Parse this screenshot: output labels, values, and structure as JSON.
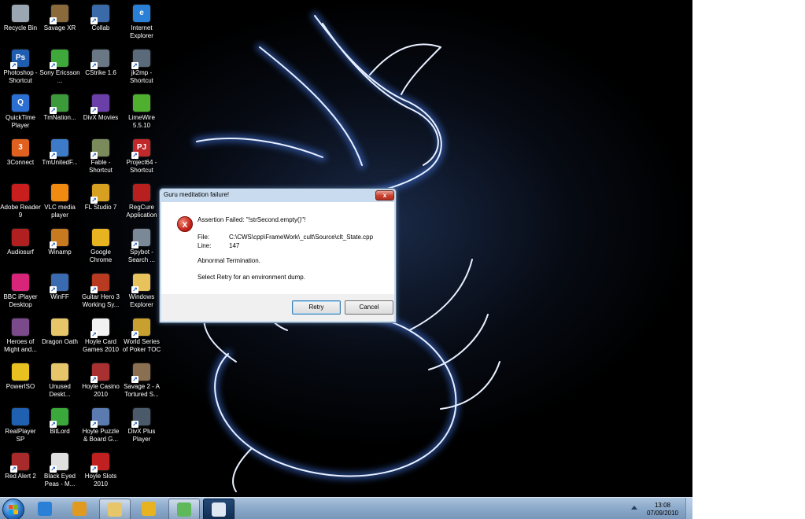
{
  "desktop": {
    "icons": [
      {
        "label": "Recycle Bin",
        "icon": "recycle-bin-icon",
        "color": "#9aa6b2",
        "glyph": "",
        "shortcut": false
      },
      {
        "label": "Savage XR",
        "icon": "savage-xr-icon",
        "color": "#8a6a3a",
        "glyph": "",
        "shortcut": true
      },
      {
        "label": "Collab",
        "icon": "collab-icon",
        "color": "#3a6aa8",
        "glyph": "",
        "shortcut": true
      },
      {
        "label": "Internet Explorer",
        "icon": "internet-explorer-icon",
        "color": "#2a7fd6",
        "glyph": "e",
        "shortcut": false
      },
      {
        "label": "Photoshop - Shortcut",
        "icon": "photoshop-icon",
        "color": "#1f5db0",
        "glyph": "Ps",
        "shortcut": true
      },
      {
        "label": "Sony Ericsson ...",
        "icon": "sony-ericsson-icon",
        "color": "#3ea83a",
        "glyph": "",
        "shortcut": true
      },
      {
        "label": "CStrike 1.6",
        "icon": "cstrike-icon",
        "color": "#6a7886",
        "glyph": "",
        "shortcut": true
      },
      {
        "label": "jk2mp - Shortcut",
        "icon": "jk2mp-icon",
        "color": "#5a6a7a",
        "glyph": "",
        "shortcut": true
      },
      {
        "label": "QuickTime Player",
        "icon": "quicktime-icon",
        "color": "#2b6fd3",
        "glyph": "Q",
        "shortcut": false
      },
      {
        "label": "TmNation...",
        "icon": "tmnations-icon",
        "color": "#3d9a3a",
        "glyph": "",
        "shortcut": true
      },
      {
        "label": "DivX Movies",
        "icon": "divx-movies-icon",
        "color": "#6a3fa8",
        "glyph": "",
        "shortcut": true
      },
      {
        "label": "LimeWire 5.5.10",
        "icon": "limewire-icon",
        "color": "#4fb030",
        "glyph": "",
        "shortcut": false
      },
      {
        "label": "3Connect",
        "icon": "3connect-icon",
        "color": "#e06020",
        "glyph": "3",
        "shortcut": false
      },
      {
        "label": "TmUnitedF...",
        "icon": "tmunited-icon",
        "color": "#3d7ac8",
        "glyph": "",
        "shortcut": true
      },
      {
        "label": "Fable - Shortcut",
        "icon": "fable-icon",
        "color": "#7a8a5a",
        "glyph": "",
        "shortcut": true
      },
      {
        "label": "Project64 - Shortcut",
        "icon": "project64-icon",
        "color": "#c0282a",
        "glyph": "PJ",
        "shortcut": true
      },
      {
        "label": "Adobe Reader 9",
        "icon": "adobe-reader-icon",
        "color": "#c81e1e",
        "glyph": "",
        "shortcut": false
      },
      {
        "label": "VLC media player",
        "icon": "vlc-icon",
        "color": "#f08a10",
        "glyph": "",
        "shortcut": false
      },
      {
        "label": "FL Studio 7",
        "icon": "fl-studio-icon",
        "color": "#d8a020",
        "glyph": "",
        "shortcut": true
      },
      {
        "label": "RegCure Application",
        "icon": "regcure-icon",
        "color": "#b82020",
        "glyph": "",
        "shortcut": false
      },
      {
        "label": "Audiosurf",
        "icon": "audiosurf-icon",
        "color": "#b02020",
        "glyph": "",
        "shortcut": false
      },
      {
        "label": "Winamp",
        "icon": "winamp-icon",
        "color": "#c87a20",
        "glyph": "",
        "shortcut": true
      },
      {
        "label": "Google Chrome",
        "icon": "google-chrome-icon",
        "color": "#e8b320",
        "glyph": "",
        "shortcut": false
      },
      {
        "label": "Spybot - Search ...",
        "icon": "spybot-icon",
        "color": "#7a8898",
        "glyph": "",
        "shortcut": true
      },
      {
        "label": "BBC iPlayer Desktop",
        "icon": "bbc-iplayer-icon",
        "color": "#d8257a",
        "glyph": "",
        "shortcut": false
      },
      {
        "label": "WinFF",
        "icon": "winff-icon",
        "color": "#3a6ab0",
        "glyph": "",
        "shortcut": true
      },
      {
        "label": "Guitar Hero 3 Working Sy...",
        "icon": "guitar-hero-icon",
        "color": "#b83a20",
        "glyph": "",
        "shortcut": true
      },
      {
        "label": "Windows Explorer",
        "icon": "windows-explorer-icon",
        "color": "#e8c25a",
        "glyph": "",
        "shortcut": true
      },
      {
        "label": "Heroes of Might and...",
        "icon": "heroes-icon",
        "color": "#7a4a8a",
        "glyph": "",
        "shortcut": false
      },
      {
        "label": "Dragon Oath",
        "icon": "dragon-oath-folder-icon",
        "color": "#e7c66a",
        "glyph": "",
        "shortcut": false
      },
      {
        "label": "Hoyle Card Games 2010",
        "icon": "hoyle-card-games-icon",
        "color": "#f2f2f2",
        "glyph": "",
        "shortcut": true
      },
      {
        "label": "World Series of Poker TOC",
        "icon": "world-series-poker-icon",
        "color": "#c8a030",
        "glyph": "",
        "shortcut": true
      },
      {
        "label": "PowerISO",
        "icon": "poweriso-icon",
        "color": "#e8c020",
        "glyph": "",
        "shortcut": false
      },
      {
        "label": "Unused Deskt...",
        "icon": "unused-desktop-folder-icon",
        "color": "#e7c66a",
        "glyph": "",
        "shortcut": false
      },
      {
        "label": "Hoyle Casino 2010",
        "icon": "hoyle-casino-icon",
        "color": "#a83030",
        "glyph": "",
        "shortcut": true
      },
      {
        "label": "Savage 2 - A Tortured S...",
        "icon": "savage2-icon",
        "color": "#8a7050",
        "glyph": "",
        "shortcut": true
      },
      {
        "label": "RealPlayer SP",
        "icon": "realplayer-icon",
        "color": "#2060b0",
        "glyph": "",
        "shortcut": false
      },
      {
        "label": "BitLord",
        "icon": "bitlord-icon",
        "color": "#3aa83a",
        "glyph": "",
        "shortcut": true
      },
      {
        "label": "Hoyle Puzzle & Board G...",
        "icon": "hoyle-puzzle-icon",
        "color": "#5a7ab0",
        "glyph": "",
        "shortcut": true
      },
      {
        "label": "DivX Plus Player",
        "icon": "divx-plus-icon",
        "color": "#4a5a6a",
        "glyph": "",
        "shortcut": true
      },
      {
        "label": "Red Alert 2",
        "icon": "red-alert-icon",
        "color": "#a82a2a",
        "glyph": "",
        "shortcut": true
      },
      {
        "label": "Black Eyed Peas - M...",
        "icon": "black-eyed-peas-icon",
        "color": "#e0e0e0",
        "glyph": "",
        "shortcut": true
      },
      {
        "label": "Hoyle Slots 2010",
        "icon": "hoyle-slots-icon",
        "color": "#c02020",
        "glyph": "",
        "shortcut": true
      }
    ]
  },
  "dialog": {
    "title": "Guru meditation failure!",
    "close_label": "x",
    "error_icon_glyph": "x",
    "assertion": "Assertion Failed: \"!strSecond.empty()\"!",
    "file_label": "File:",
    "file_value": "C:\\CWS\\cpp\\FrameWork\\_cult\\Source\\clt_State.cpp",
    "line_label": "Line:",
    "line_value": "147",
    "abnormal": "Abnormal Termination.",
    "retry_hint": "Select Retry for an environment dump.",
    "retry_button": "Retry",
    "cancel_button": "Cancel"
  },
  "taskbar": {
    "buttons": [
      {
        "name": "taskbar-internet-explorer",
        "icon": "internet-explorer-icon",
        "color": "#2a7fd6",
        "state": "pinned"
      },
      {
        "name": "taskbar-winamp",
        "icon": "winamp-icon",
        "color": "#e09a20",
        "state": "pinned"
      },
      {
        "name": "taskbar-windows-explorer",
        "icon": "folder-icon",
        "color": "#e7c66a",
        "state": "open"
      },
      {
        "name": "taskbar-google-chrome",
        "icon": "google-chrome-icon",
        "color": "#e8b320",
        "state": "pinned"
      },
      {
        "name": "taskbar-messenger",
        "icon": "messenger-icon",
        "color": "#5fb85a",
        "state": "open"
      },
      {
        "name": "taskbar-dialog-app",
        "icon": "application-icon",
        "color": "#dfe8f2",
        "state": "active"
      }
    ],
    "clock_time": "13:08",
    "clock_date": "07/09/2010"
  }
}
